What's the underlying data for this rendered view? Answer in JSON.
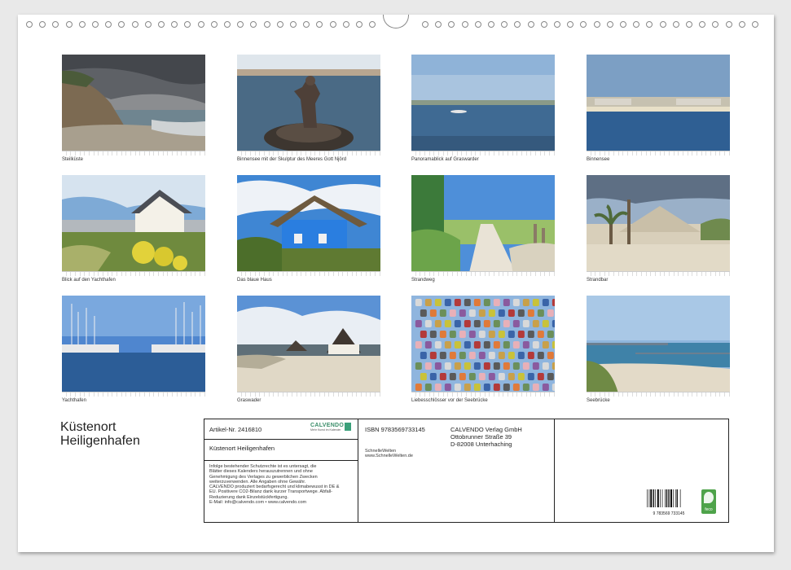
{
  "photos": [
    {
      "caption": "Steilküste"
    },
    {
      "caption": "Binnensee mit der Skulptur des Meeres Gott Njörd"
    },
    {
      "caption": "Panoramablick auf Graswarder"
    },
    {
      "caption": "Binnensee"
    },
    {
      "caption": "Blick auf den Yachthafen"
    },
    {
      "caption": "Das blaue Haus"
    },
    {
      "caption": "Strandweg"
    },
    {
      "caption": "Strandbar"
    },
    {
      "caption": "Yachthafen"
    },
    {
      "caption": "Graswader"
    },
    {
      "caption": "Liebesschlösser vor der Seebrücke"
    },
    {
      "caption": "Seebrücke"
    }
  ],
  "title_line1": "Küstenort",
  "title_line2": "Heiligenhafen",
  "info": {
    "article": "Artikel-Nr. 2416810",
    "brand": "CALVENDO",
    "brand_sub": "Mehr Kunst im Kalender",
    "product_title": "Küstenort Heiligenhafen",
    "legal": [
      "Infolge bestehender Schutzrechte ist es untersagt, die",
      "Blätter dieses Kalenders herauszutrennen und ohne",
      "Genehmigung des Verlages zu gewerblichen Zwecken",
      "weiterzuverwenden. Alle Angaben ohne Gewähr.",
      "CALVENDO produziert bedarfsgerecht und klimabewusst in DE &",
      "EU. Positivere CO2-Bilanz dank kurzer Transportwege. Abfall-",
      "Reduzierung dank Einzelstückfertigung.",
      "E-Mail: info@calvendo.com • www.calvendo.com"
    ],
    "isbn": "ISBN 9783569733145",
    "author": "SchnelleWelten",
    "author_url": "www.SchnelleWelten.de",
    "publisher_name": "CALVENDO Verlag GmbH",
    "publisher_street": "Ottobrunner Straße 39",
    "publisher_city": "D-82008 Unterhaching",
    "barcode_text": "9 783569 733145",
    "badge": "feco"
  }
}
